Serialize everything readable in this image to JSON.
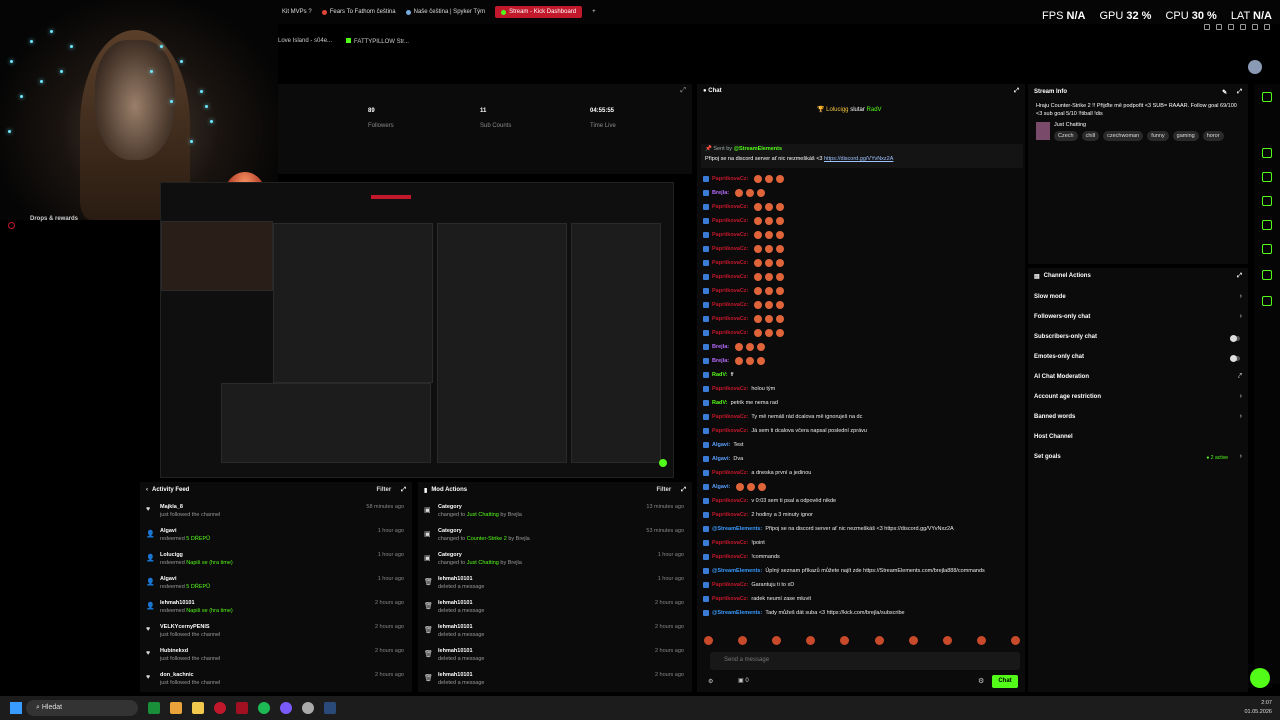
{
  "browser": {
    "tabs": [
      {
        "label": "Kit MVPs ?",
        "active": false
      },
      {
        "label": "Fears To Fathom čeština",
        "active": false
      },
      {
        "label": "Naše čeština | Spyker Tým",
        "active": false
      },
      {
        "label": "Stream - Kick Dashboard",
        "active": true
      }
    ],
    "new_tab": "+",
    "bookmarks": [
      "Love Island - s04e...",
      "FATTYPILLOW Str..."
    ]
  },
  "system_stats": {
    "fps_label": "FPS",
    "fps": "N/A",
    "gpu_label": "GPU",
    "gpu": "32 %",
    "cpu_label": "CPU",
    "cpu": "30 %",
    "lat_label": "LAT",
    "lat": "N/A"
  },
  "stream_stats": {
    "followers": {
      "value": "89",
      "label": "Followers"
    },
    "subs": {
      "value": "11",
      "label": "Sub Counts"
    },
    "time": {
      "value": "04:55:55",
      "label": "Time Live"
    }
  },
  "sidebar": {
    "drops": "Drops & rewards"
  },
  "activity_feed": {
    "title": "Activity Feed",
    "filter": "Filter",
    "items": [
      {
        "name": "Majkla_8",
        "desc": "just followed the channel",
        "highlight": "",
        "time": "58 minutes ago"
      },
      {
        "name": "Algavi",
        "desc": "redeemed",
        "highlight": "5 DŘEPŮ",
        "time": "1 hour ago"
      },
      {
        "name": "Lolucigg",
        "desc": "redeemed",
        "highlight": "Napiš se (hra time)",
        "time": "1 hour ago"
      },
      {
        "name": "Algavi",
        "desc": "redeemed",
        "highlight": "5 DŘEPŮ",
        "time": "1 hour ago"
      },
      {
        "name": "lehmah10101",
        "desc": "redeemed",
        "highlight": "Napiš se (hra time)",
        "time": "2 hours ago"
      },
      {
        "name": "VELKYcernyPENIS",
        "desc": "just followed the channel",
        "highlight": "",
        "time": "2 hours ago"
      },
      {
        "name": "Hubinekxd",
        "desc": "just followed the channel",
        "highlight": "",
        "time": "2 hours ago"
      },
      {
        "name": "don_kachnic",
        "desc": "just followed the channel",
        "highlight": "",
        "time": "2 hours ago"
      }
    ]
  },
  "mod_actions": {
    "title": "Mod Actions",
    "filter": "Filter",
    "items": [
      {
        "name": "Category",
        "desc": "changed to",
        "highlight": "Just Chatting",
        "by": "by Brejla",
        "time": "13 minutes ago"
      },
      {
        "name": "Category",
        "desc": "changed to",
        "highlight": "Counter-Strike 2",
        "by": "by Brejla",
        "time": "53 minutes ago"
      },
      {
        "name": "Category",
        "desc": "changed to",
        "highlight": "Just Chatting",
        "by": "by Brejla",
        "time": "1 hour ago"
      },
      {
        "name": "lehmah10101",
        "desc": "deleted a message",
        "highlight": "",
        "by": "",
        "time": "1 hour ago"
      },
      {
        "name": "lehmah10101",
        "desc": "deleted a message",
        "highlight": "",
        "by": "",
        "time": "2 hours ago"
      },
      {
        "name": "lehmah10101",
        "desc": "deleted a message",
        "highlight": "",
        "by": "",
        "time": "2 hours ago"
      },
      {
        "name": "lehmah10101",
        "desc": "deleted a message",
        "highlight": "",
        "by": "",
        "time": "2 hours ago"
      },
      {
        "name": "lehmah10101",
        "desc": "deleted a message",
        "highlight": "",
        "by": "",
        "time": "2 hours ago"
      }
    ]
  },
  "chat": {
    "title": "Chat",
    "leaders": [
      "Lolucigg",
      "slutar",
      "RadV"
    ],
    "pinned_author": "Sent by",
    "pinned_user": "@StreamElements",
    "pinned_text": "Připoj se na discord server ať nic nezmeškáš <3",
    "pinned_link": "https://discord.gg/VYvNxz2A",
    "messages": [
      {
        "user": "PapriikovaCz",
        "color": "#c2182b",
        "text": ""
      },
      {
        "user": "Brejla",
        "color": "#b56bff",
        "text": ""
      },
      {
        "user": "PapriikovaCz",
        "color": "#c2182b",
        "text": ""
      },
      {
        "user": "PapriikovaCz",
        "color": "#c2182b",
        "text": ""
      },
      {
        "user": "PapriikovaCz",
        "color": "#c2182b",
        "text": ""
      },
      {
        "user": "PapriikovaCz",
        "color": "#c2182b",
        "text": ""
      },
      {
        "user": "PapriikovaCz",
        "color": "#c2182b",
        "text": ""
      },
      {
        "user": "PapriikovaCz",
        "color": "#c2182b",
        "text": ""
      },
      {
        "user": "PapriikovaCz",
        "color": "#c2182b",
        "text": ""
      },
      {
        "user": "PapriikovaCz",
        "color": "#c2182b",
        "text": ""
      },
      {
        "user": "PapriikovaCz",
        "color": "#c2182b",
        "text": ""
      },
      {
        "user": "PapriikovaCz",
        "color": "#c2182b",
        "text": ""
      },
      {
        "user": "Brejla",
        "color": "#b56bff",
        "text": ""
      },
      {
        "user": "Brejla",
        "color": "#b56bff",
        "text": ""
      },
      {
        "user": "RadV",
        "color": "#53fc18",
        "text": "ff"
      },
      {
        "user": "PapriikovaCz",
        "color": "#c2182b",
        "text": "holou tým"
      },
      {
        "user": "RadV",
        "color": "#53fc18",
        "text": "petrik me nema rad"
      },
      {
        "user": "PapriikovaCz",
        "color": "#c2182b",
        "text": "Ty mě nemáš rád dcalova mě ignoruješ na dc"
      },
      {
        "user": "PapriikovaCz",
        "color": "#c2182b",
        "text": "Já sem ti dcalova včera napsal poslední zprávu"
      },
      {
        "user": "Algavi",
        "color": "#5aa0ff",
        "text": "Test"
      },
      {
        "user": "Algavi",
        "color": "#5aa0ff",
        "text": "Dva"
      },
      {
        "user": "PapriikovaCz",
        "color": "#c2182b",
        "text": "a dneska první a jedinou"
      },
      {
        "user": "Algavi",
        "color": "#5aa0ff",
        "text": ""
      },
      {
        "user": "PapriikovaCz",
        "color": "#c2182b",
        "text": "v 0:03 sem ti psal a odpověd nikde"
      },
      {
        "user": "PapriikovaCz",
        "color": "#c2182b",
        "text": "2 hodiny a 3 minuty ignor"
      },
      {
        "user": "@StreamElements",
        "color": "#3a9bff",
        "text": "Připoj se na discord server ať nic nezmeškáš <3 https://discord.gg/VYvNxz2A"
      },
      {
        "user": "PapriikovaCz",
        "color": "#c2182b",
        "text": "!point"
      },
      {
        "user": "PapriikovaCz",
        "color": "#c2182b",
        "text": "!commands"
      },
      {
        "user": "@StreamElements",
        "color": "#3a9bff",
        "text": "Úplný seznam příkazů můžete najít zde https://StreamElements.com/brejla888/commands"
      },
      {
        "user": "PapriikovaCz",
        "color": "#c2182b",
        "text": "Garantuju ti to xD"
      },
      {
        "user": "PapriikovaCz",
        "color": "#c2182b",
        "text": "radek neumí zase mluvit"
      },
      {
        "user": "@StreamElements",
        "color": "#3a9bff",
        "text": "Tady můžeš dát suba <3 https://kick.com/brejla/subscribe"
      }
    ],
    "input_placeholder": "Send a message",
    "points": "0",
    "send_label": "Chat"
  },
  "stream_info": {
    "title": "Stream Info",
    "stream_title": "Hraju Counter-Strike 2 !! Přijďte mě podpořit <3 SUB= RAAAR. Follow goal 69/100 <3 sub goal 5/10 !!tiball !dis",
    "category": "Just Chatting",
    "tags": [
      "Czech",
      "chill",
      "czechwoman",
      "funny",
      "gaming",
      "horor"
    ]
  },
  "channel_actions": {
    "title": "Channel Actions",
    "items": [
      {
        "label": "Slow mode",
        "control": "chevron"
      },
      {
        "label": "Followers-only chat",
        "control": "chevron"
      },
      {
        "label": "Subscribers-only chat",
        "control": "toggle"
      },
      {
        "label": "Emotes-only chat",
        "control": "toggle"
      },
      {
        "label": "AI Chat Moderation",
        "control": "external"
      },
      {
        "label": "Account age restriction",
        "control": "chevron"
      },
      {
        "label": "Banned words",
        "control": "chevron"
      },
      {
        "label": "Host Channel",
        "control": ""
      },
      {
        "label": "Set goals",
        "control": "chevron"
      }
    ],
    "goals_active": "2 active"
  },
  "taskbar": {
    "search_placeholder": "Hledat",
    "time": "2:07",
    "date": "01.05.2026"
  },
  "colors": {
    "accent": "#53fc18",
    "live": "#c2182b",
    "panel": "#0b0b0b"
  }
}
